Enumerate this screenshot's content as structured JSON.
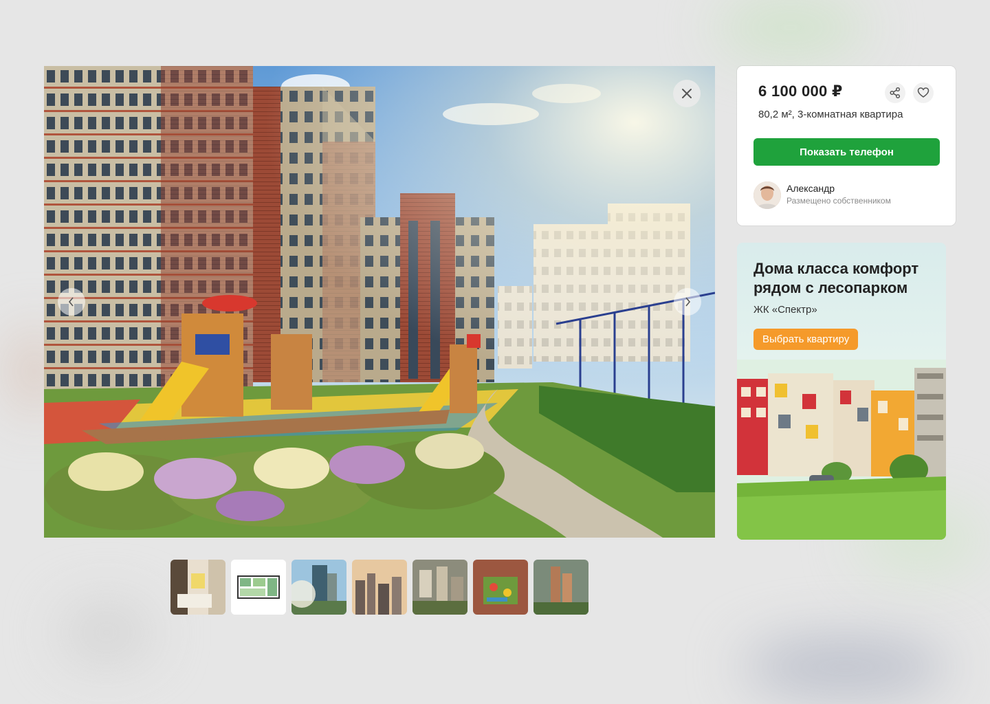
{
  "gallery": {
    "close_icon": "close-icon",
    "prev_icon": "chevron-left-icon",
    "next_icon": "chevron-right-icon",
    "thumbnails": [
      "interior-photo",
      "floor-plan",
      "tower-photo",
      "city-panorama",
      "aerial-view",
      "courtyard-aerial",
      "complex-aerial"
    ]
  },
  "listing": {
    "price": "6 100 000 ₽",
    "description": "80,2 м², 3-комнатная квартира",
    "share_icon": "share-icon",
    "favorite_icon": "heart-icon",
    "phone_button": "Показать телефон",
    "seller": {
      "name": "Александр",
      "note": "Размещено собственником"
    }
  },
  "ad": {
    "title": "Дома класса комфорт рядом с лесопарком",
    "subtitle": "ЖК «Спектр»",
    "button": "Выбрать квартиру"
  },
  "colors": {
    "accent_green": "#1fa23c",
    "accent_orange": "#f59a2a"
  }
}
